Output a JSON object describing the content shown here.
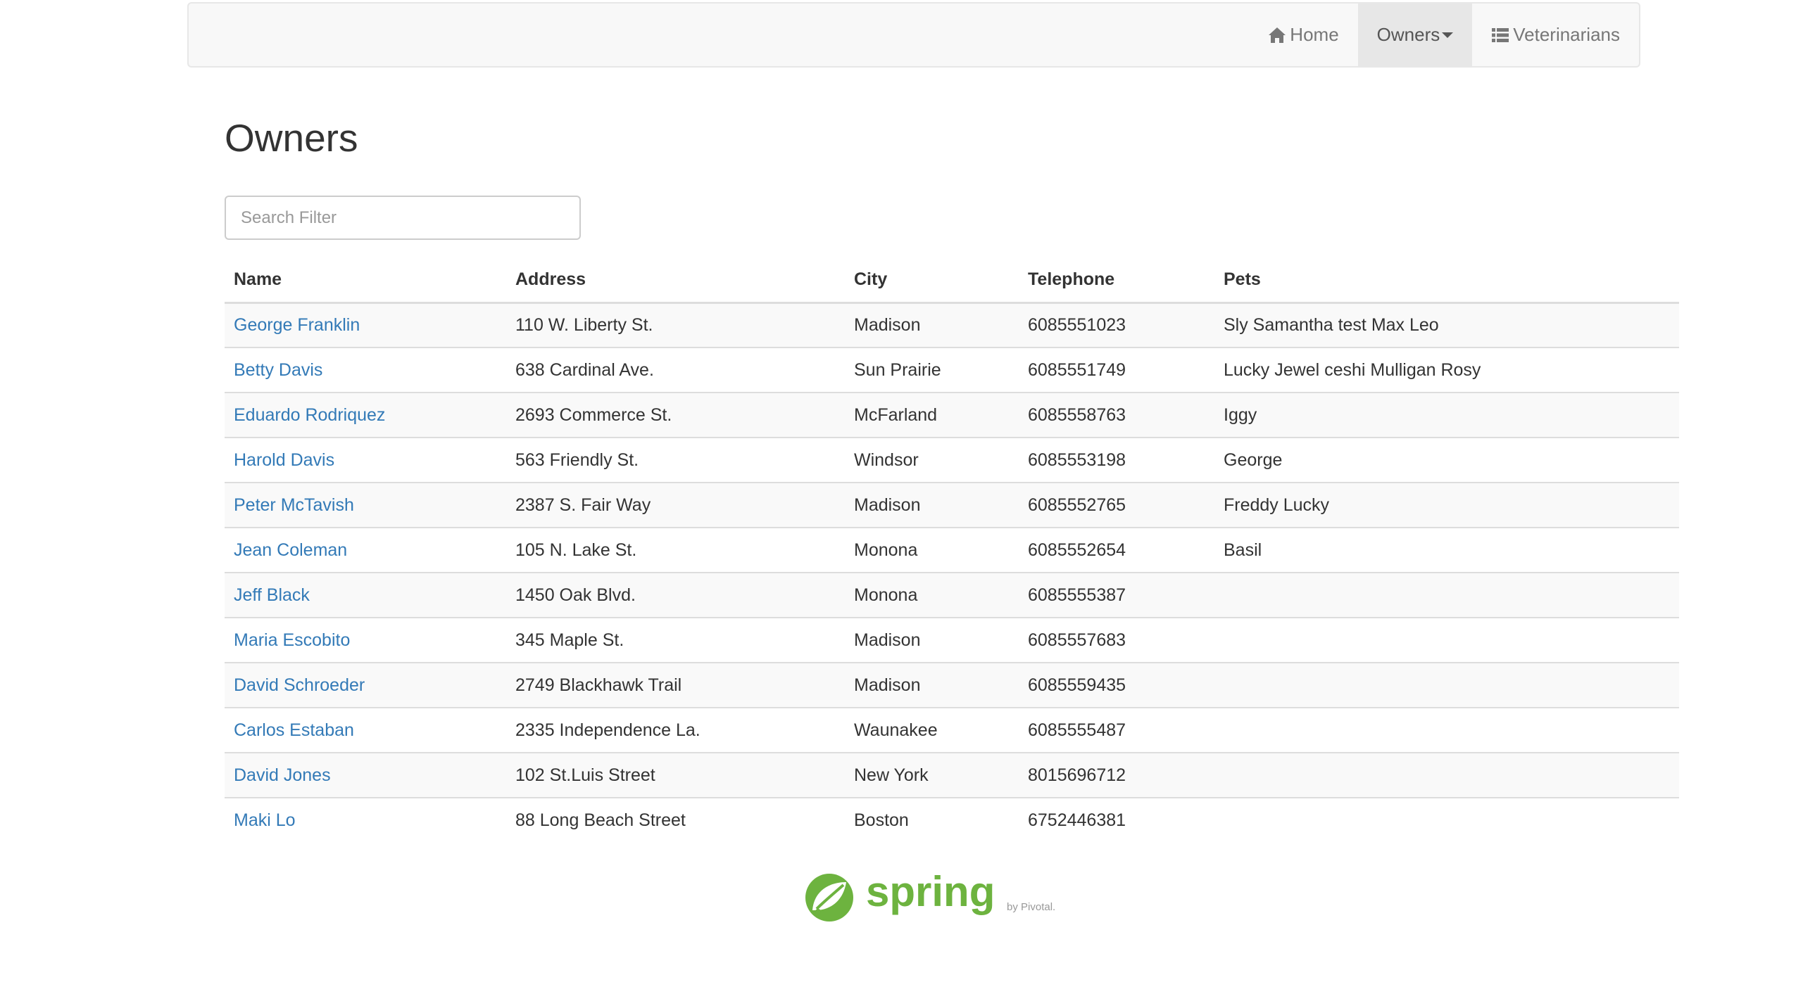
{
  "nav": {
    "home": "Home",
    "owners": "Owners",
    "veterinarians": "Veterinarians"
  },
  "page": {
    "title": "Owners"
  },
  "search": {
    "placeholder": "Search Filter"
  },
  "table": {
    "headers": [
      "Name",
      "Address",
      "City",
      "Telephone",
      "Pets"
    ],
    "rows": [
      {
        "name": "George Franklin",
        "address": "110 W. Liberty St.",
        "city": "Madison",
        "telephone": "6085551023",
        "pets": "Sly Samantha test Max Leo"
      },
      {
        "name": "Betty Davis",
        "address": "638 Cardinal Ave.",
        "city": "Sun Prairie",
        "telephone": "6085551749",
        "pets": "Lucky Jewel ceshi Mulligan Rosy"
      },
      {
        "name": "Eduardo Rodriquez",
        "address": "2693 Commerce St.",
        "city": "McFarland",
        "telephone": "6085558763",
        "pets": "Iggy"
      },
      {
        "name": "Harold Davis",
        "address": "563 Friendly St.",
        "city": "Windsor",
        "telephone": "6085553198",
        "pets": "George"
      },
      {
        "name": "Peter McTavish",
        "address": "2387 S. Fair Way",
        "city": "Madison",
        "telephone": "6085552765",
        "pets": "Freddy Lucky"
      },
      {
        "name": "Jean Coleman",
        "address": "105 N. Lake St.",
        "city": "Monona",
        "telephone": "6085552654",
        "pets": "Basil"
      },
      {
        "name": "Jeff Black",
        "address": "1450 Oak Blvd.",
        "city": "Monona",
        "telephone": "6085555387",
        "pets": ""
      },
      {
        "name": "Maria Escobito",
        "address": "345 Maple St.",
        "city": "Madison",
        "telephone": "6085557683",
        "pets": ""
      },
      {
        "name": "David Schroeder",
        "address": "2749 Blackhawk Trail",
        "city": "Madison",
        "telephone": "6085559435",
        "pets": ""
      },
      {
        "name": "Carlos Estaban",
        "address": "2335 Independence La.",
        "city": "Waunakee",
        "telephone": "6085555487",
        "pets": ""
      },
      {
        "name": "David Jones",
        "address": "102 St.Luis Street",
        "city": "New York",
        "telephone": "8015696712",
        "pets": ""
      },
      {
        "name": "Maki Lo",
        "address": "88 Long Beach Street",
        "city": "Boston",
        "telephone": "6752446381",
        "pets": ""
      }
    ]
  },
  "footer": {
    "logo_text": "spring",
    "logo_byline": "by Pivotal.",
    "brand_color": "#6db33f"
  },
  "colors": {
    "link": "#337ab7",
    "navbar_bg": "#f8f8f8",
    "nav_active_bg": "#e7e7e7"
  }
}
